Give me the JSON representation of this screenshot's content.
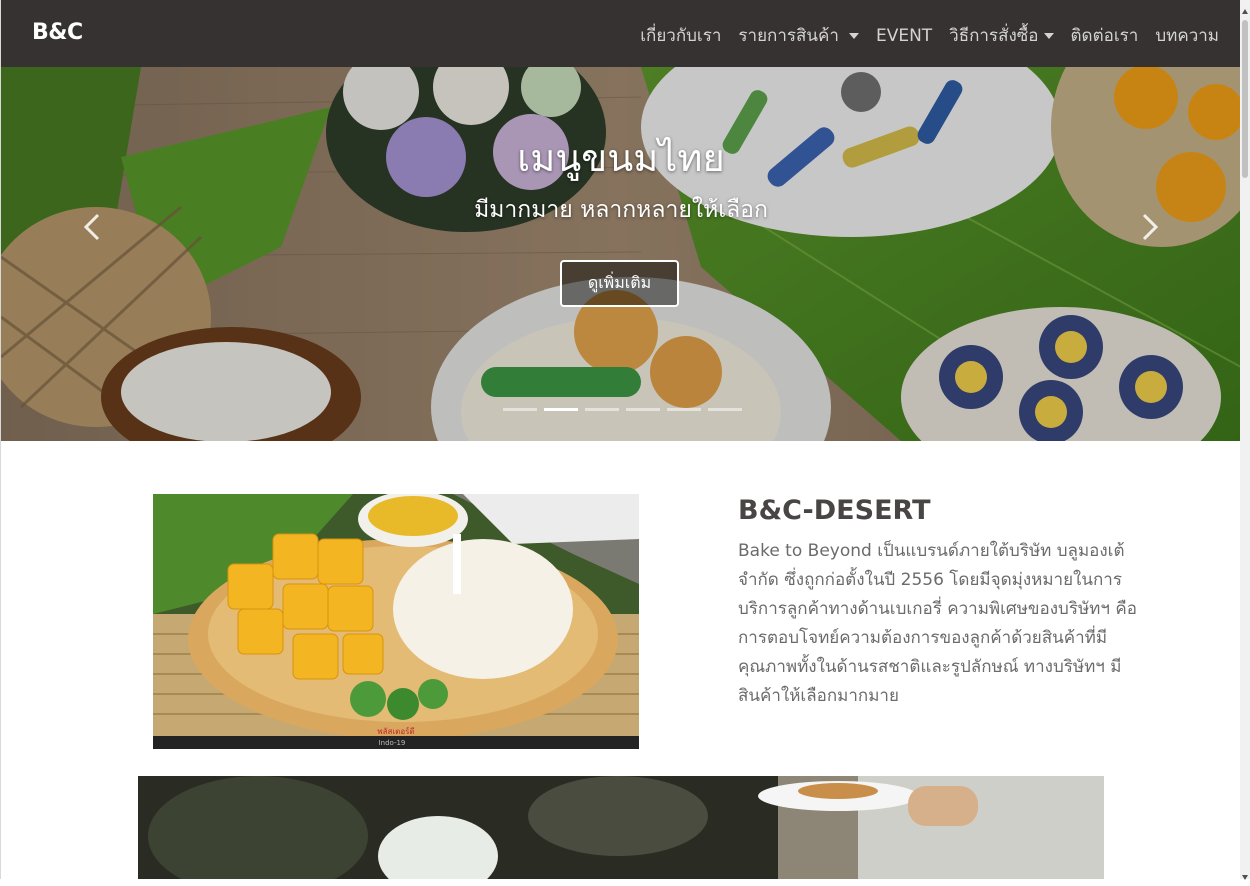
{
  "navbar": {
    "brand": "B&C",
    "items": [
      {
        "label": "เกี่ยวกับเรา",
        "dropdown": false
      },
      {
        "label": "รายการสินค้า",
        "dropdown": true
      },
      {
        "label": "EVENT",
        "dropdown": false
      },
      {
        "label": "วิธีการสั่งซื้อ",
        "dropdown": true
      },
      {
        "label": "ติดต่อเรา",
        "dropdown": false
      },
      {
        "label": "บทความ",
        "dropdown": false
      }
    ]
  },
  "hero": {
    "title": "เมนูขนมไทย",
    "subtitle": "มีมากมาย หลากหลายให้เลือก",
    "button_label": "ดูเพิ่มเติม",
    "slide_count": 6,
    "active_slide": 2
  },
  "about": {
    "title": "B&C-DESERT",
    "text": "Bake to Beyond เป็นแบรนด์ภายใต้บริษัท บลูมองเต้ จำกัด ซึ่งถูกก่อตั้งในปี 2556 โดยมีจุดมุ่งหมายในการบริการลูกค้าทางด้านเบเกอรี่ ความพิเศษของบริษัทฯ คือการตอบโจทย์ความต้องการของลูกค้าด้วยสินค้าที่มีคุณภาพทั้งในด้านรสชาติและรูปลักษณ์ ทางบริษัทฯ มีสินค้าให้เลือกมากมาย",
    "image_watermark": "พลัสเตอร์ดี",
    "image_caption": "Indo-19"
  },
  "colors": {
    "navbar_bg": "#373232",
    "nav_text": "#d3d3d3",
    "heading": "#4a4545",
    "body_text": "#6b6b6b"
  }
}
